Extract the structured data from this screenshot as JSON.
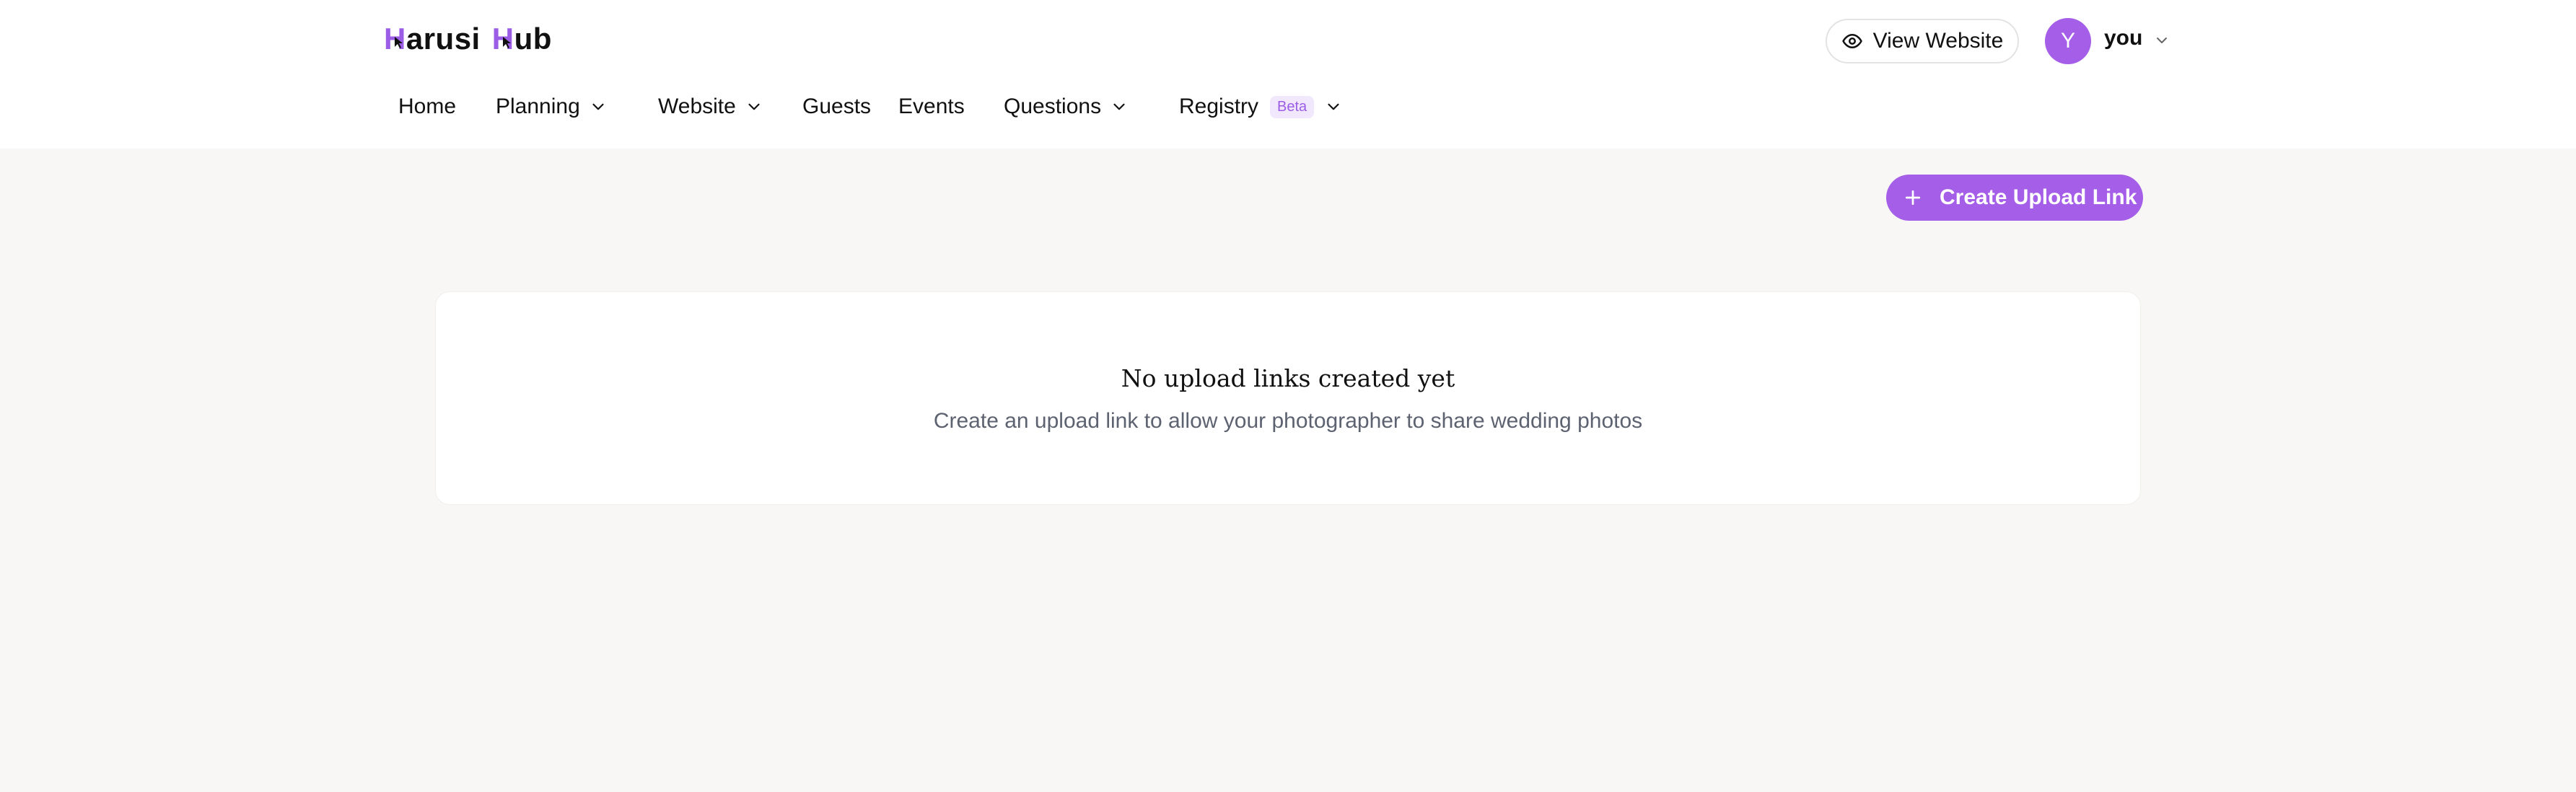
{
  "app": {
    "logo_parts": [
      "H",
      "arusi",
      "H",
      "ub"
    ]
  },
  "header": {
    "view_website_label": "View Website",
    "avatar_initial": "Y",
    "user_name": "you"
  },
  "nav": {
    "home": "Home",
    "planning": "Planning",
    "website": "Website",
    "guests": "Guests",
    "events": "Events",
    "questions": "Questions",
    "registry": "Registry",
    "registry_badge": "Beta"
  },
  "toolbar": {
    "create_upload_link_label": "Create Upload Link"
  },
  "empty_state": {
    "title": "No upload links created yet",
    "subtitle": "Create an upload link to allow your photographer to share wedding photos"
  },
  "colors": {
    "accent": "#a55ee8",
    "background": "#f8f7f5"
  }
}
